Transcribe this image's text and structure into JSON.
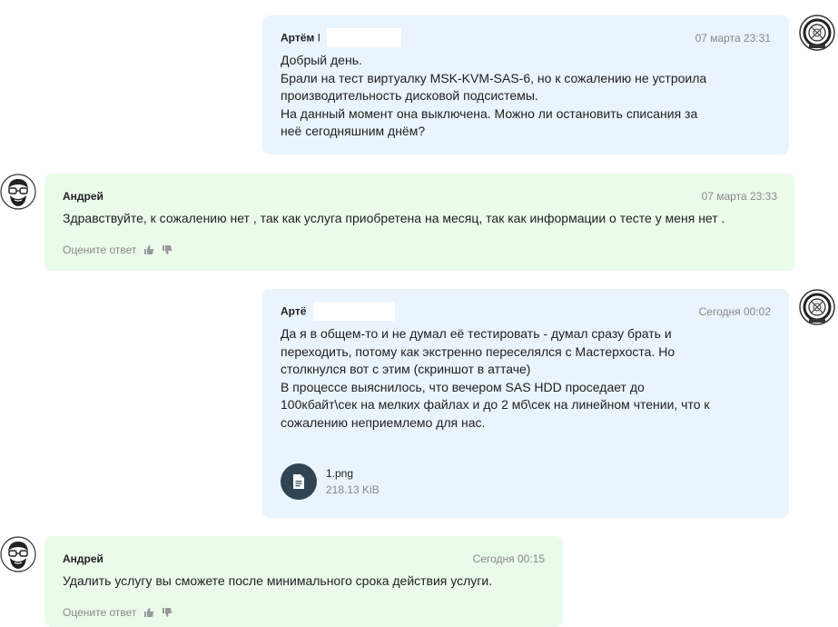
{
  "messages": [
    {
      "author": "Артём",
      "author_suffix": "I",
      "time": "07 марта 23:31",
      "text": "Добрый день.\nБрали на тест виртуалку MSK-KVM-SAS-6, но к сожалению не устроила производительность дисковой подсистемы.\nНа данный момент она выключена. Можно ли остановить списания за неё сегодняшним днём?"
    },
    {
      "author": "Андрей",
      "time": "07 марта 23:33",
      "text": "Здравствуйте, к сожалению нет , так как услуга приобретена на месяц, так как информации о тесте у меня нет .",
      "rate_label": "Оцените ответ"
    },
    {
      "author": "Артё",
      "time": "Сегодня 00:02",
      "text": "Да я в общем-то и не думал её тестировать - думал сразу брать и переходить, потому как экстренно переселялся с Мастерхоста. Но столкнулся вот с этим (скриншот в аттаче)\nВ процессе выяснилось, что вечером SAS HDD проседает до 100кбайт\\сек на мелких файлах и до 2 мб\\сек на линейном чтении, что к сожалению неприемлемо для нас.",
      "attachment": {
        "name": "1.png",
        "size": "218.13 KiB"
      }
    },
    {
      "author": "Андрей",
      "time": "Сегодня 00:15",
      "text": "Удалить услугу вы сможете после минимального срока действия услуги.",
      "rate_label": "Оцените ответ"
    }
  ],
  "icons": {
    "client_avatar": "round-robot-avatar",
    "support_avatar": "bearded-man-glasses-avatar",
    "thumb_up": "thumb-up-icon",
    "thumb_down": "thumb-down-icon",
    "file": "file-icon"
  }
}
